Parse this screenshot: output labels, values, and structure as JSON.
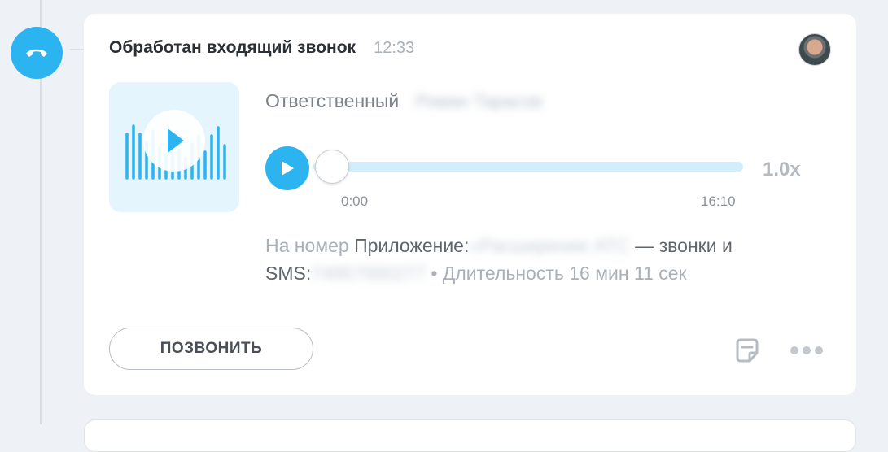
{
  "event": {
    "title": "Обработан входящий звонок",
    "time": "12:33",
    "icon": "phone-hangup-icon",
    "accent_color": "#2bb4ef"
  },
  "responsible": {
    "label": "Ответственный",
    "name": "Роман Тарасов"
  },
  "player": {
    "current_time": "0:00",
    "total_time": "16:10",
    "speed": "1.0x",
    "progress": 0
  },
  "details": {
    "prefix": "На номер",
    "app_label": "Приложение:",
    "app_name": "«Расширение АТС",
    "suffix": "— звонки и",
    "sms_label": "SMS:",
    "sms_number": "74957000277",
    "separator": "•",
    "duration": "Длительность 16 мин 11 сек"
  },
  "actions": {
    "call_label": "ПОЗВОНИТЬ",
    "note_icon": "note-icon",
    "more_icon": "more-dots-icon"
  }
}
